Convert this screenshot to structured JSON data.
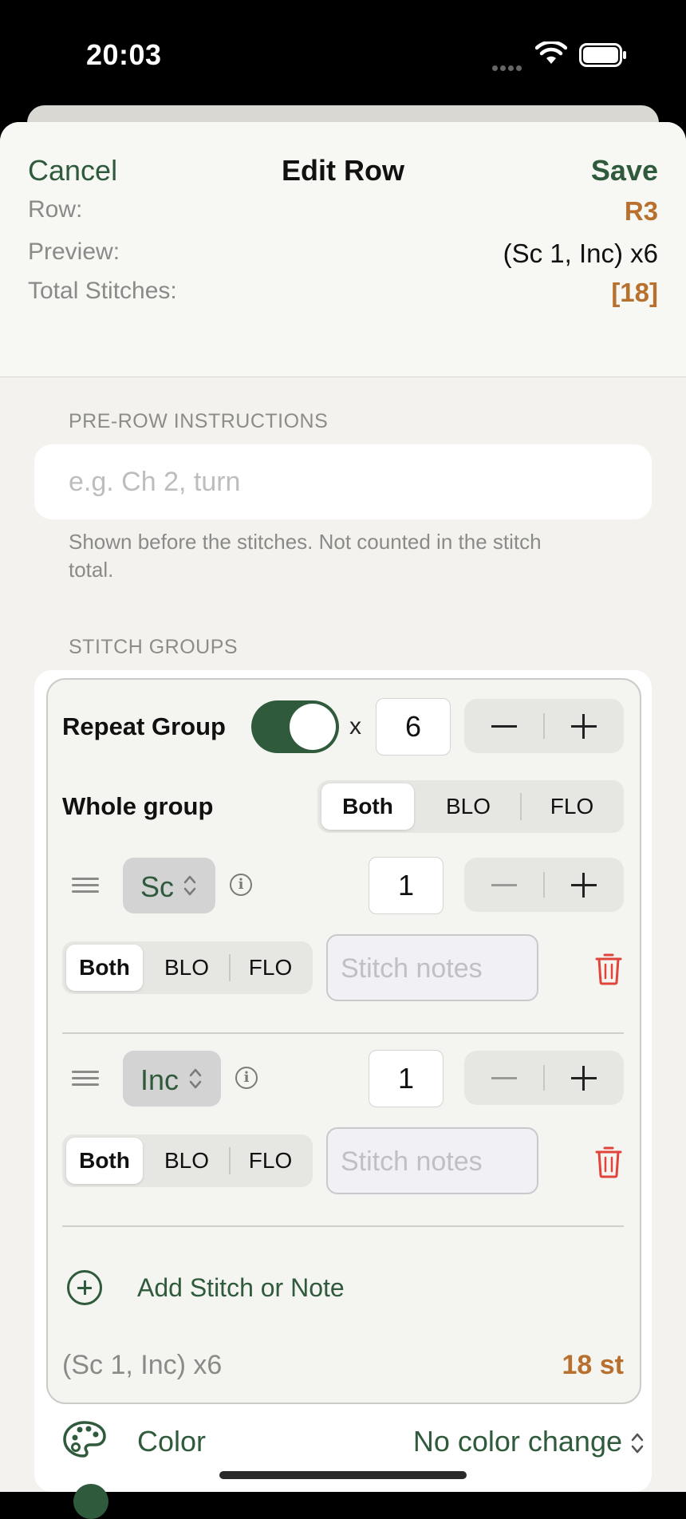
{
  "status": {
    "time": "20:03"
  },
  "nav": {
    "cancel_label": "Cancel",
    "title": "Edit Row",
    "save_label": "Save"
  },
  "info": {
    "row_label": "Row:",
    "row_value": "R3",
    "preview_label": "Preview:",
    "preview_value": "(Sc 1, Inc) x6",
    "total_label": "Total Stitches:",
    "total_value": "[18]"
  },
  "pre_row": {
    "section_label": "PRE-ROW INSTRUCTIONS",
    "placeholder": "e.g. Ch 2, turn",
    "footnote": "Shown before the stitches. Not counted in the stitch total."
  },
  "stitch_groups": {
    "section_label": "STITCH GROUPS",
    "repeat_label": "Repeat Group",
    "repeat_enabled": true,
    "repeat_x": "x",
    "repeat_count": "6",
    "whole_group_label": "Whole group",
    "whole_group_options": [
      "Both",
      "BLO",
      "FLO"
    ],
    "whole_group_selected": "Both",
    "stitches": [
      {
        "name": "Sc",
        "count": "1",
        "loop_options": [
          "Both",
          "BLO",
          "FLO"
        ],
        "loop_selected": "Both",
        "notes_placeholder": "Stitch notes"
      },
      {
        "name": "Inc",
        "count": "1",
        "loop_options": [
          "Both",
          "BLO",
          "FLO"
        ],
        "loop_selected": "Both",
        "notes_placeholder": "Stitch notes"
      }
    ],
    "add_label": "Add Stitch or Note",
    "summary_text": "(Sc 1, Inc) x6",
    "summary_count": "18 st"
  },
  "color": {
    "label": "Color",
    "value": "No color change"
  },
  "colors": {
    "accent_green": "#2f5a3c",
    "accent_orange": "#b8702e",
    "delete_red": "#e0443a"
  }
}
